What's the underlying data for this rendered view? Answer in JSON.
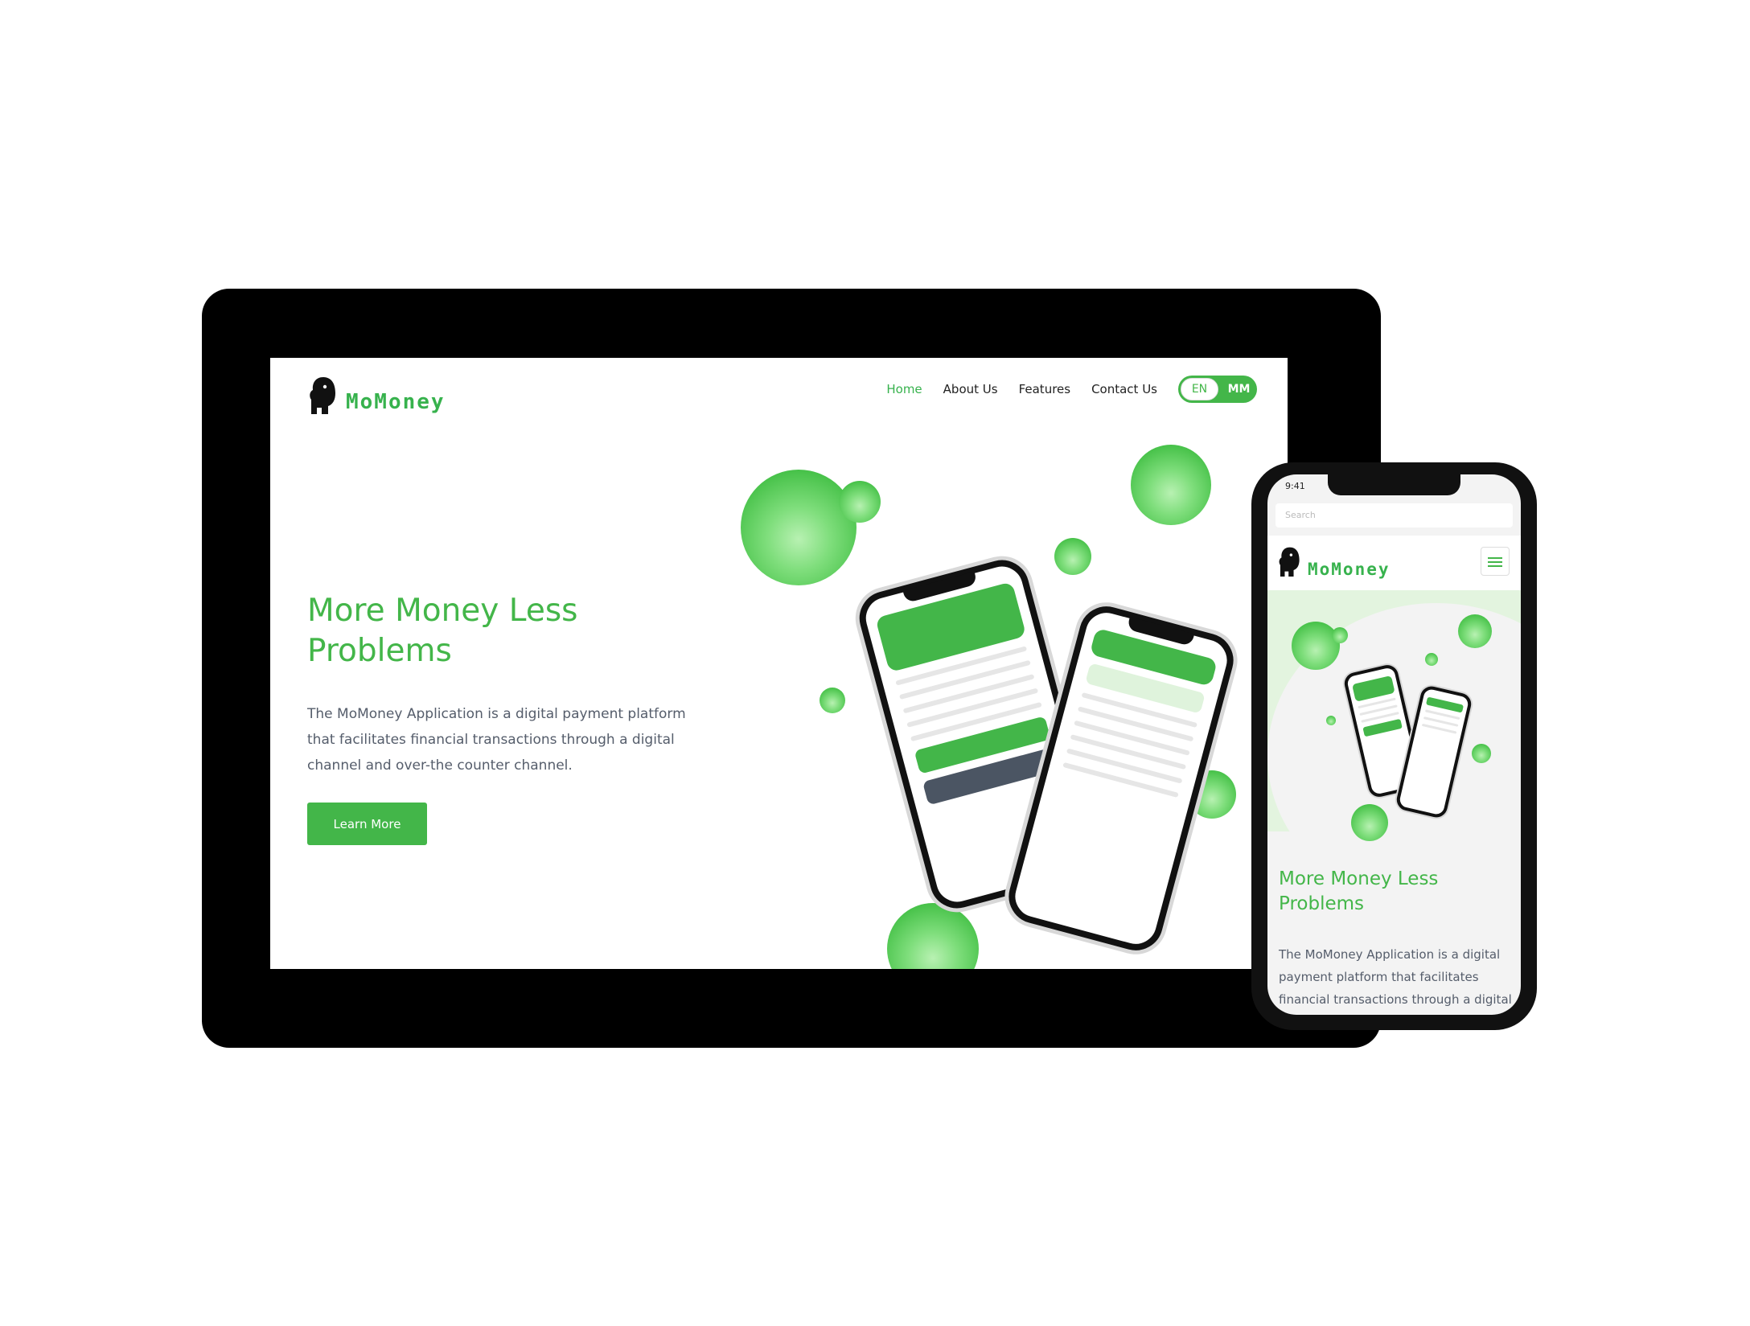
{
  "brand": {
    "name": "MoMoney",
    "accent": "#43b649",
    "dark": "#111111"
  },
  "desktop": {
    "nav": {
      "items": [
        {
          "label": "Home",
          "active": true
        },
        {
          "label": "About Us",
          "active": false
        },
        {
          "label": "Features",
          "active": false
        },
        {
          "label": "Contact Us",
          "active": false
        }
      ],
      "lang": {
        "en": "EN",
        "mm": "MM"
      }
    },
    "hero": {
      "title": "More Money Less Problems",
      "text": "The MoMoney Application is a digital payment platform that facilitates financial transactions through a digital channel and over-the counter channel.",
      "button": "Learn More"
    }
  },
  "mobile": {
    "status_time": "9:41",
    "search_placeholder": "Search",
    "hero": {
      "title": "More Money Less Problems",
      "text": "The MoMoney Application is a digital payment platform that facilitates financial transactions through a digital"
    }
  },
  "icons": {
    "logo": "elephant-logo-icon",
    "menu": "hamburger-menu-icon"
  }
}
